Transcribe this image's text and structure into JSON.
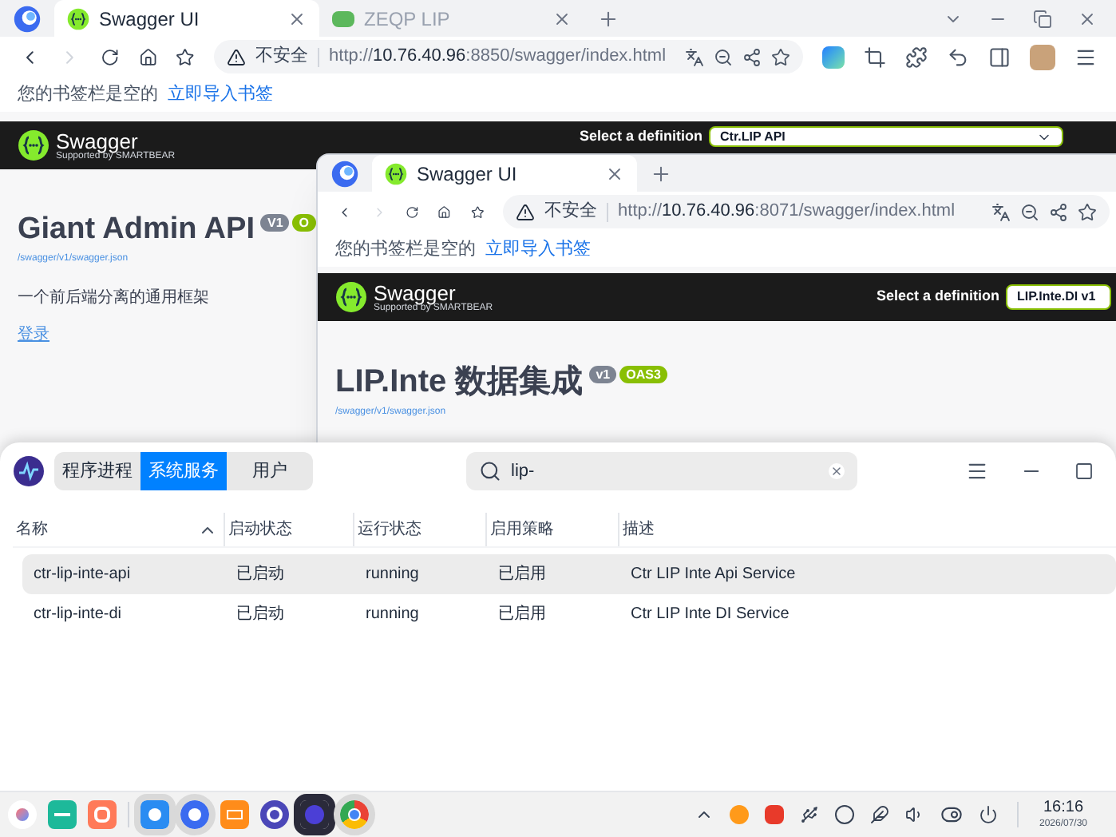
{
  "back_browser": {
    "tabs": [
      {
        "title": "Swagger UI",
        "selected": true
      },
      {
        "title": "ZEQP LIP",
        "selected": false
      }
    ],
    "security_label": "不安全",
    "url_scheme": "http://",
    "url_host": "10.76.40.96",
    "url_path": ":8850/swagger/index.html",
    "bookmarks_empty": "您的书签栏是空的",
    "bookmarks_import": "立即导入书签",
    "swagger": {
      "brand": "Swagger",
      "tagline": "Supported by SMARTBEAR",
      "definition_label": "Select a definition",
      "definition_value": "Ctr.LIP API"
    },
    "page": {
      "title": "Giant Admin API",
      "version": "V1",
      "oas": "O",
      "spec_link": "/swagger/v1/swagger.json",
      "description": "一个前后端分离的通用框架",
      "login_link": "登录"
    }
  },
  "front_browser": {
    "tabs": [
      {
        "title": "Swagger UI",
        "selected": true
      }
    ],
    "security_label": "不安全",
    "url_scheme": "http://",
    "url_host": "10.76.40.96",
    "url_path": ":8071/swagger/index.html",
    "bookmarks_empty": "您的书签栏是空的",
    "bookmarks_import": "立即导入书签",
    "swagger": {
      "brand": "Swagger",
      "tagline": "Supported by SMARTBEAR",
      "definition_label": "Select a definition",
      "definition_value": "LIP.Inte.DI v1"
    },
    "page": {
      "title": "LIP.Inte 数据集成",
      "version": "v1",
      "oas": "OAS3",
      "spec_link": "/swagger/v1/swagger.json"
    }
  },
  "system_monitor": {
    "tabs": [
      {
        "label": "程序进程",
        "selected": false
      },
      {
        "label": "系统服务",
        "selected": true
      },
      {
        "label": "用户",
        "selected": false
      }
    ],
    "search": {
      "value": "lip-"
    },
    "columns": [
      {
        "label": "名称",
        "sorted": true
      },
      {
        "label": "启动状态",
        "sorted": false
      },
      {
        "label": "运行状态",
        "sorted": false
      },
      {
        "label": "启用策略",
        "sorted": false
      },
      {
        "label": "描述",
        "sorted": false
      }
    ],
    "rows": [
      {
        "selected": true,
        "cells": [
          "ctr-lip-inte-api",
          "已启动",
          "running",
          "已启用",
          "Ctr LIP Inte Api Service"
        ]
      },
      {
        "selected": false,
        "cells": [
          "ctr-lip-inte-di",
          "已启动",
          "running",
          "已启用",
          "Ctr LIP Inte DI Service"
        ]
      }
    ]
  },
  "taskbar": {
    "time": "16:16",
    "date": "2026/07/30"
  }
}
